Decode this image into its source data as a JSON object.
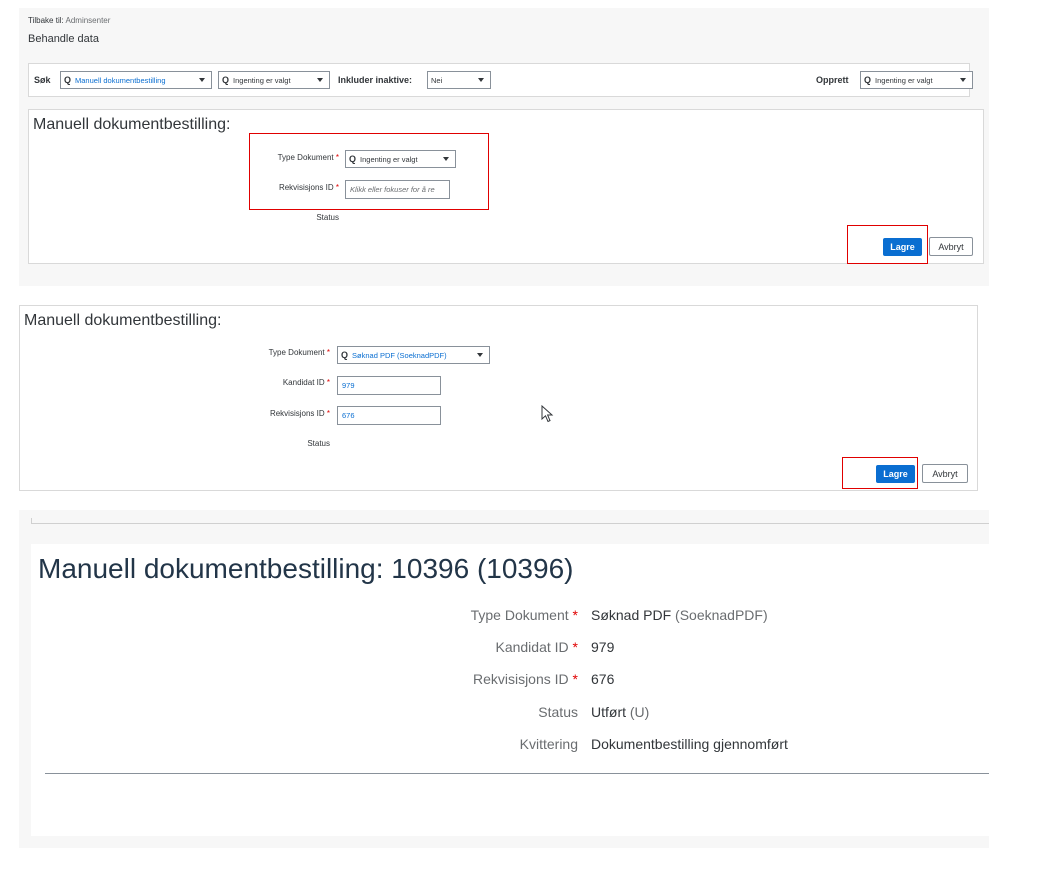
{
  "panel1": {
    "back_prefix": "Tilbake til:",
    "back_link": "Adminsenter",
    "page_title": "Behandle data",
    "filterbar": {
      "search_label": "Søk",
      "search_value": "Manuell dokumentbestilling",
      "second_value": "Ingenting er valgt",
      "include_inactive_label": "Inkluder inaktive:",
      "include_inactive_value": "Nei",
      "create_label": "Opprett",
      "create_value": "Ingenting er valgt"
    },
    "form": {
      "title": "Manuell dokumentbestilling:",
      "type_label": "Type Dokument",
      "type_value": "Ingenting er valgt",
      "rekv_label": "Rekvisisjons ID",
      "rekv_placeholder": "Klikk eller fokuser for å re",
      "status_label": "Status",
      "save_label": "Lagre",
      "cancel_label": "Avbryt"
    }
  },
  "panel2": {
    "title": "Manuell dokumentbestilling:",
    "type_label": "Type Dokument",
    "type_value": "Søknad PDF (SoeknadPDF)",
    "kandidat_label": "Kandidat ID",
    "kandidat_value": "979",
    "rekv_label": "Rekvisisjons ID",
    "rekv_value": "676",
    "status_label": "Status",
    "save_label": "Lagre",
    "cancel_label": "Avbryt"
  },
  "panel3": {
    "title": "Manuell dokumentbestilling: 10396 (10396)",
    "rows": [
      {
        "label": "Type Dokument",
        "required": true,
        "value": "Søknad PDF",
        "suffix": "(SoeknadPDF)"
      },
      {
        "label": "Kandidat ID",
        "required": true,
        "value": "979",
        "suffix": ""
      },
      {
        "label": "Rekvisisjons ID",
        "required": true,
        "value": "676",
        "suffix": ""
      },
      {
        "label": "Status",
        "required": false,
        "value": "Utført",
        "suffix": "(U)"
      },
      {
        "label": "Kvittering",
        "required": false,
        "value": "Dokumentbestilling gjennomført",
        "suffix": ""
      }
    ]
  },
  "required_marker": "*",
  "search_glyph": "Q",
  "colors": {
    "primary": "#0a6ed1",
    "required": "#e00000",
    "highlight": "#e00000"
  },
  "icons": [
    "search-icon",
    "caret-down-icon",
    "mouse-cursor-icon"
  ]
}
